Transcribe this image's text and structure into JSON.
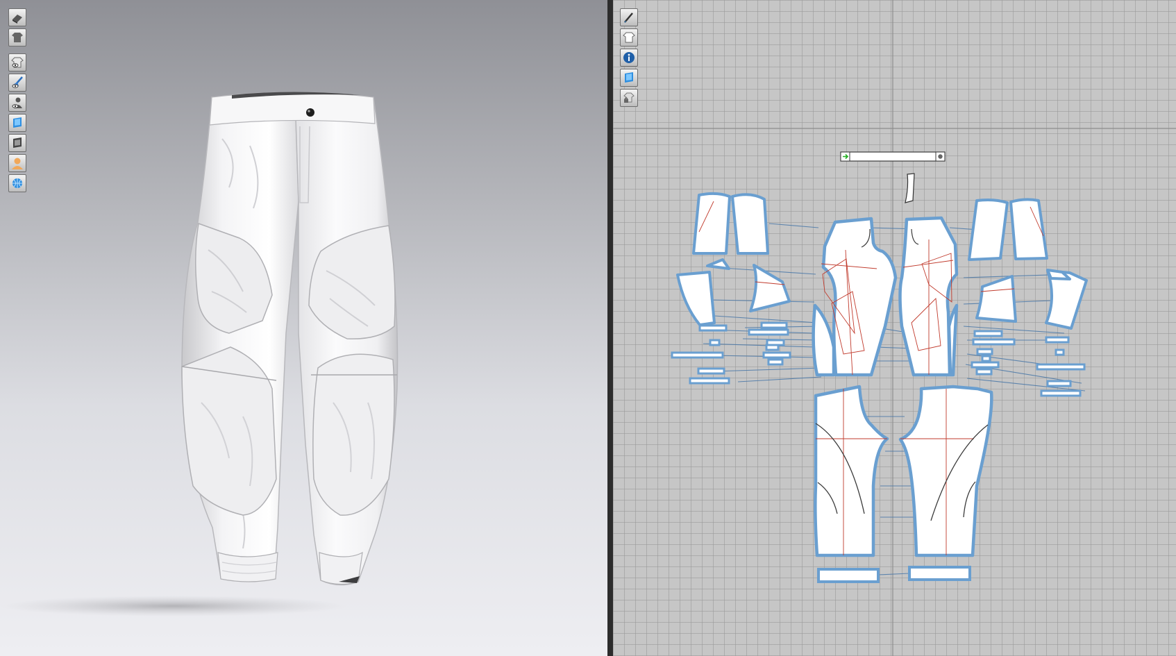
{
  "viewport_3d": {
    "toolbar": [
      {
        "icon": "avatar-display-icon"
      },
      {
        "icon": "garment-display-icon"
      },
      {
        "icon": "show-garment-icon"
      },
      {
        "icon": "show-pin-icon"
      },
      {
        "icon": "show-avatar-icon"
      },
      {
        "icon": "texture-surface-icon"
      },
      {
        "icon": "shaded-surface-icon"
      },
      {
        "icon": "avatar-skin-icon"
      },
      {
        "icon": "mesh-wireframe-icon"
      }
    ],
    "background_colors": [
      "#8f9096",
      "#eeeef2"
    ]
  },
  "viewport_2d": {
    "toolbar": [
      {
        "icon": "edit-pattern-icon"
      },
      {
        "icon": "pattern-display-icon"
      },
      {
        "icon": "info-icon"
      },
      {
        "icon": "texture-view-icon"
      },
      {
        "icon": "lock-pattern-icon"
      }
    ],
    "outline_color": "#6a9fd0",
    "seam_color": "#4a78a8",
    "internal_line_color": "#c0392b",
    "grid_color": "#c6c6c6"
  }
}
